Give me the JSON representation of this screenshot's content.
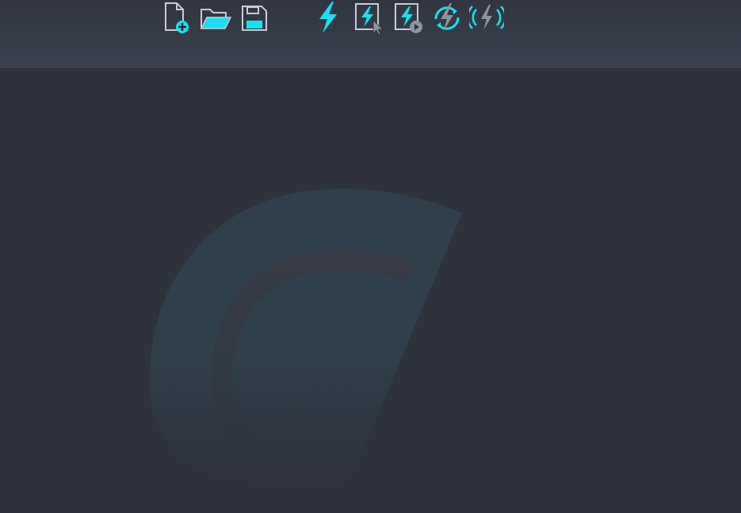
{
  "toolbar": {
    "groups": [
      {
        "name": "file",
        "buttons": [
          {
            "id": "new-file",
            "icon": "new-file-icon"
          },
          {
            "id": "open-folder",
            "icon": "open-folder-icon"
          },
          {
            "id": "save",
            "icon": "save-icon"
          }
        ]
      },
      {
        "name": "actions",
        "buttons": [
          {
            "id": "run",
            "icon": "lightning-icon"
          },
          {
            "id": "run-selected",
            "icon": "lightning-cursor-icon"
          },
          {
            "id": "run-play",
            "icon": "lightning-play-icon"
          },
          {
            "id": "refresh-run",
            "icon": "lightning-refresh-icon"
          },
          {
            "id": "broadcast",
            "icon": "lightning-broadcast-icon"
          }
        ]
      }
    ]
  },
  "colors": {
    "background": "#2e323c",
    "toolbar": "#3b414e",
    "accent": "#17e1f0",
    "icon_gray": "#8e949e",
    "watermark": "#2f3e4a"
  },
  "watermark": {
    "icon": "app-logo-watermark"
  }
}
